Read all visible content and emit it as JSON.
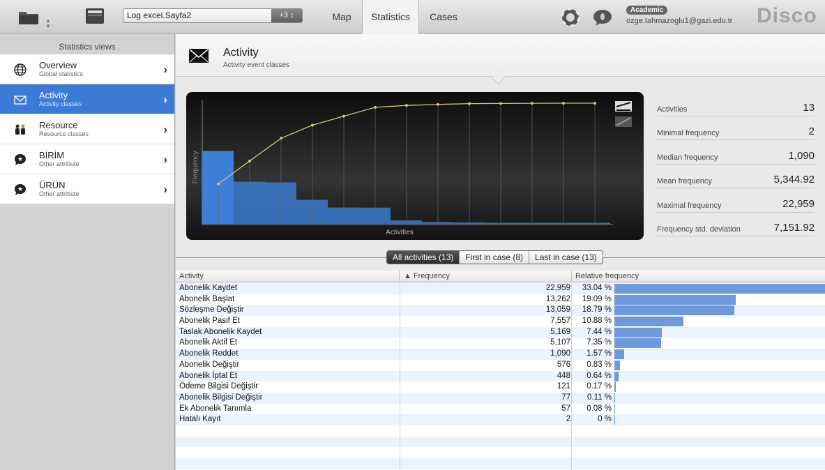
{
  "topbar": {
    "dataset_name": "Log excel.Sayfa2",
    "dataset_badge": "+3 ↕",
    "tabs": [
      "Map",
      "Statistics",
      "Cases"
    ],
    "active_tab": "Statistics",
    "account_type": "Academic",
    "account_email": "ozge.tahmazoglu1@gazi.edu.tr",
    "brand": "Disco"
  },
  "sidebar": {
    "title": "Statistics views",
    "items": [
      {
        "label": "Overview",
        "sub": "Global statistics",
        "icon": "globe-icon"
      },
      {
        "label": "Activity",
        "sub": "Activity classes",
        "icon": "envelope-icon",
        "active": true
      },
      {
        "label": "Resource",
        "sub": "Resource classes",
        "icon": "people-icon"
      },
      {
        "label": "BİRİM",
        "sub": "Other attribute",
        "icon": "star-bubble-icon"
      },
      {
        "label": "ÜRÜN",
        "sub": "Other attribute",
        "icon": "star-bubble-icon"
      }
    ]
  },
  "header": {
    "title": "Activity",
    "subtitle": "Activity event classes"
  },
  "stats": [
    {
      "label": "Activities",
      "value": "13"
    },
    {
      "label": "Minimal frequency",
      "value": "2"
    },
    {
      "label": "Median frequency",
      "value": "1,090"
    },
    {
      "label": "Mean frequency",
      "value": "5,344.92"
    },
    {
      "label": "Maximal frequency",
      "value": "22,959"
    },
    {
      "label": "Frequency std. deviation",
      "value": "7,151.92"
    }
  ],
  "segments": {
    "all": "All activities (13)",
    "first": "First in case (8)",
    "last": "Last in case (13)"
  },
  "table": {
    "columns": {
      "activity": "Activity",
      "frequency": "▲ Frequency",
      "relative": "Relative frequency"
    },
    "rows": [
      {
        "activity": "Abonelik Kaydet",
        "frequency": "22,959",
        "relative": "33.04 %"
      },
      {
        "activity": "Abonelik Başlat",
        "frequency": "13,262",
        "relative": "19.09 %"
      },
      {
        "activity": "Sözleşme Değiştir",
        "frequency": "13,059",
        "relative": "18.79 %"
      },
      {
        "activity": "Abonelik Pasif Et",
        "frequency": "7,557",
        "relative": "10.88 %"
      },
      {
        "activity": "Taslak Abonelik Kaydet",
        "frequency": "5,169",
        "relative": "7.44 %"
      },
      {
        "activity": "Abonelik Aktif Et",
        "frequency": "5,107",
        "relative": "7.35 %"
      },
      {
        "activity": "Abonelik Reddet",
        "frequency": "1,090",
        "relative": "1.57 %"
      },
      {
        "activity": "Abonelik Değiştir",
        "frequency": "576",
        "relative": "0.83 %"
      },
      {
        "activity": "Abonelik İptal Et",
        "frequency": "448",
        "relative": "0.64 %"
      },
      {
        "activity": "Ödeme Bilgisi Değiştir",
        "frequency": "121",
        "relative": "0.17 %"
      },
      {
        "activity": "Abonelik Bilgisi Değiştir",
        "frequency": "77",
        "relative": "0.11 %"
      },
      {
        "activity": "Ek Abonelik Tanımla",
        "frequency": "57",
        "relative": "0.08 %"
      },
      {
        "activity": "Hatalı Kayıt",
        "frequency": "2",
        "relative": "0 %"
      }
    ]
  },
  "chart_data": {
    "type": "bar",
    "xlabel": "Activities",
    "ylabel": "Frequency",
    "categories": [
      "Abonelik Kaydet",
      "Abonelik Başlat",
      "Sözleşme Değiştir",
      "Abonelik Pasif Et",
      "Taslak Abonelik Kaydet",
      "Abonelik Aktif Et",
      "Abonelik Reddet",
      "Abonelik Değiştir",
      "Abonelik İptal Et",
      "Ödeme Bilgisi Değiştir",
      "Abonelik Bilgisi Değiştir",
      "Ek Abonelik Tanımla",
      "Hatalı Kayıt"
    ],
    "series": [
      {
        "type": "bar",
        "values": [
          22959,
          13262,
          13059,
          7557,
          5169,
          5107,
          1090,
          576,
          448,
          121,
          77,
          57,
          2
        ]
      },
      {
        "type": "line",
        "values": [
          33.04,
          52.13,
          70.92,
          81.8,
          89.24,
          96.59,
          98.16,
          98.99,
          99.63,
          99.8,
          99.91,
          99.99,
          100.0
        ]
      }
    ],
    "colors": {
      "bar": "#3b7fd6",
      "line": "#d3c28a"
    },
    "grid": false,
    "legend": "none"
  },
  "colors": {
    "accent": "#3b7bd6",
    "bar_table": "#6e99dc"
  }
}
